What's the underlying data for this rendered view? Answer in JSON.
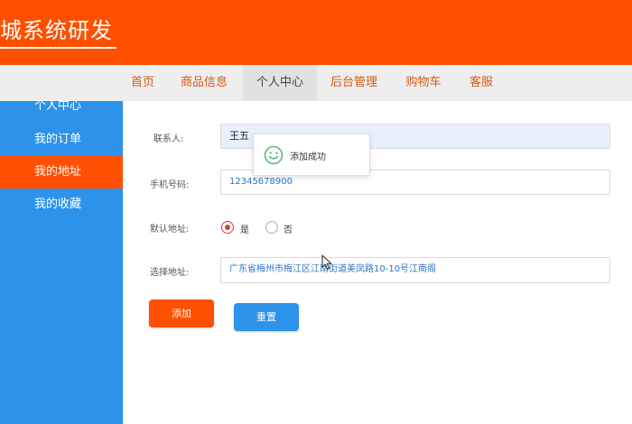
{
  "header": {
    "brand": "城系统研发"
  },
  "nav": {
    "items": [
      "首页",
      "商品信息",
      "个人中心",
      "后台管理",
      "购物车",
      "客服"
    ],
    "active": "个人中心"
  },
  "sidebar": {
    "items": [
      "个人中心",
      "我的订单",
      "我的地址",
      "我的收藏"
    ],
    "active": "我的地址"
  },
  "form": {
    "contact_label": "联系人:",
    "contact_value": "王五",
    "phone_label": "手机号码:",
    "phone_value": "12345678900",
    "default_label": "默认地址:",
    "default_yes": "是",
    "default_no": "否",
    "default_selected": "是",
    "address_label": "选择地址:",
    "address_value": "广东省梅州市梅江区江南街道美凤路10-10号江南阁",
    "add_button": "添加",
    "reset_button": "重置"
  },
  "toast": {
    "message": "添加成功",
    "icon": "smile-icon"
  },
  "colors": {
    "brand_orange": "#fe5000",
    "sidebar_blue": "#2d93ea",
    "success_green": "#5fb878"
  }
}
